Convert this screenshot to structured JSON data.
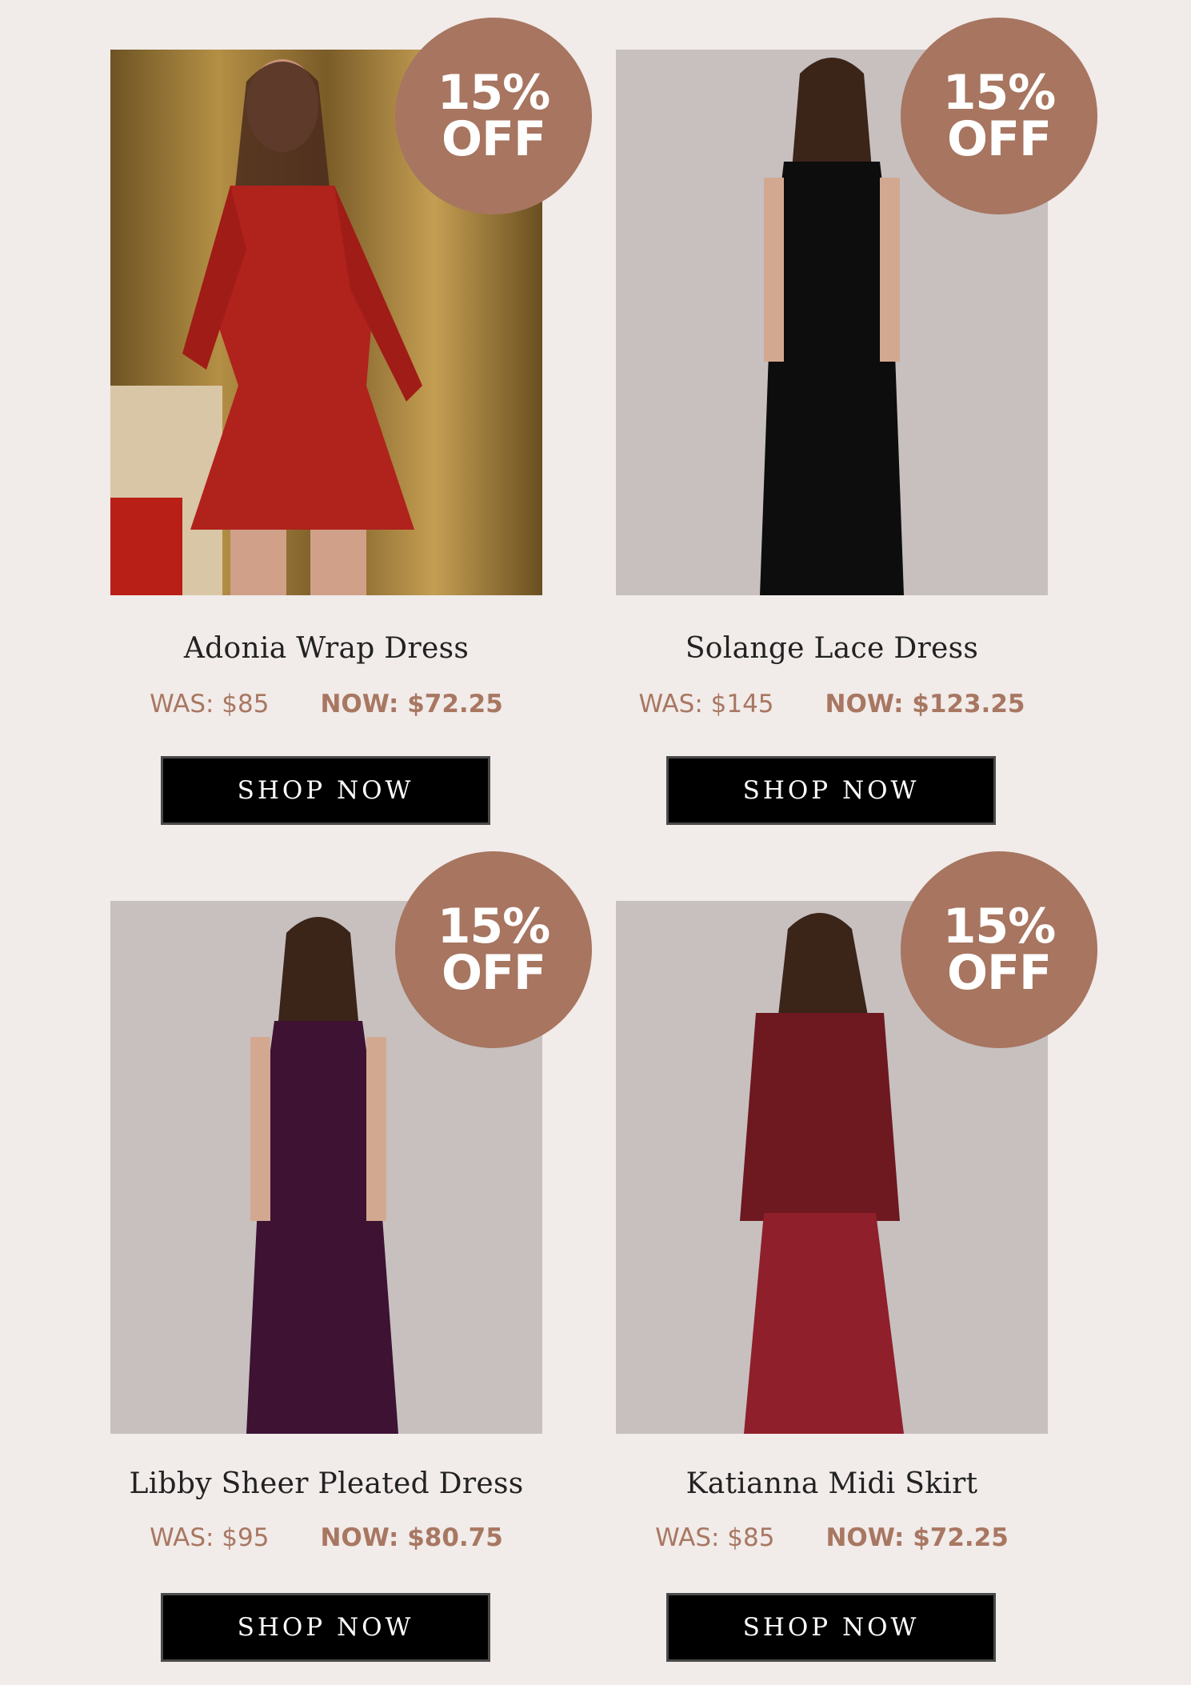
{
  "products": [
    {
      "name": "Adonia Wrap Dress",
      "was": "WAS: $85",
      "now": "NOW: $72.25",
      "badge_line1": "15%",
      "badge_line2": "OFF",
      "cta": "SHOP NOW",
      "image": "model-red-floral-wrap-dress",
      "garment_color": "#b0221c"
    },
    {
      "name": "Solange Lace Dress",
      "was": "WAS: $145",
      "now": "NOW: $123.25",
      "badge_line1": "15%",
      "badge_line2": "OFF",
      "cta": "SHOP NOW",
      "image": "model-black-lace-maxi-dress",
      "garment_color": "#0d0d0d"
    },
    {
      "name": "Libby Sheer Pleated Dress",
      "was": "WAS: $95",
      "now": "NOW: $80.75",
      "badge_line1": "15%",
      "badge_line2": "OFF",
      "cta": "SHOP NOW",
      "image": "model-plum-pleated-dress",
      "garment_color": "#3d1233"
    },
    {
      "name": "Katianna Midi Skirt",
      "was": "WAS: $85",
      "now": "NOW: $72.25",
      "badge_line1": "15%",
      "badge_line2": "OFF",
      "cta": "SHOP NOW",
      "image": "model-burgundy-sweater-satin-skirt",
      "garment_color": "#7a1a22"
    }
  ],
  "colors": {
    "background": "#f1ebe9",
    "badge": "#a77560",
    "price_text": "#a87762",
    "button": "#000000"
  }
}
